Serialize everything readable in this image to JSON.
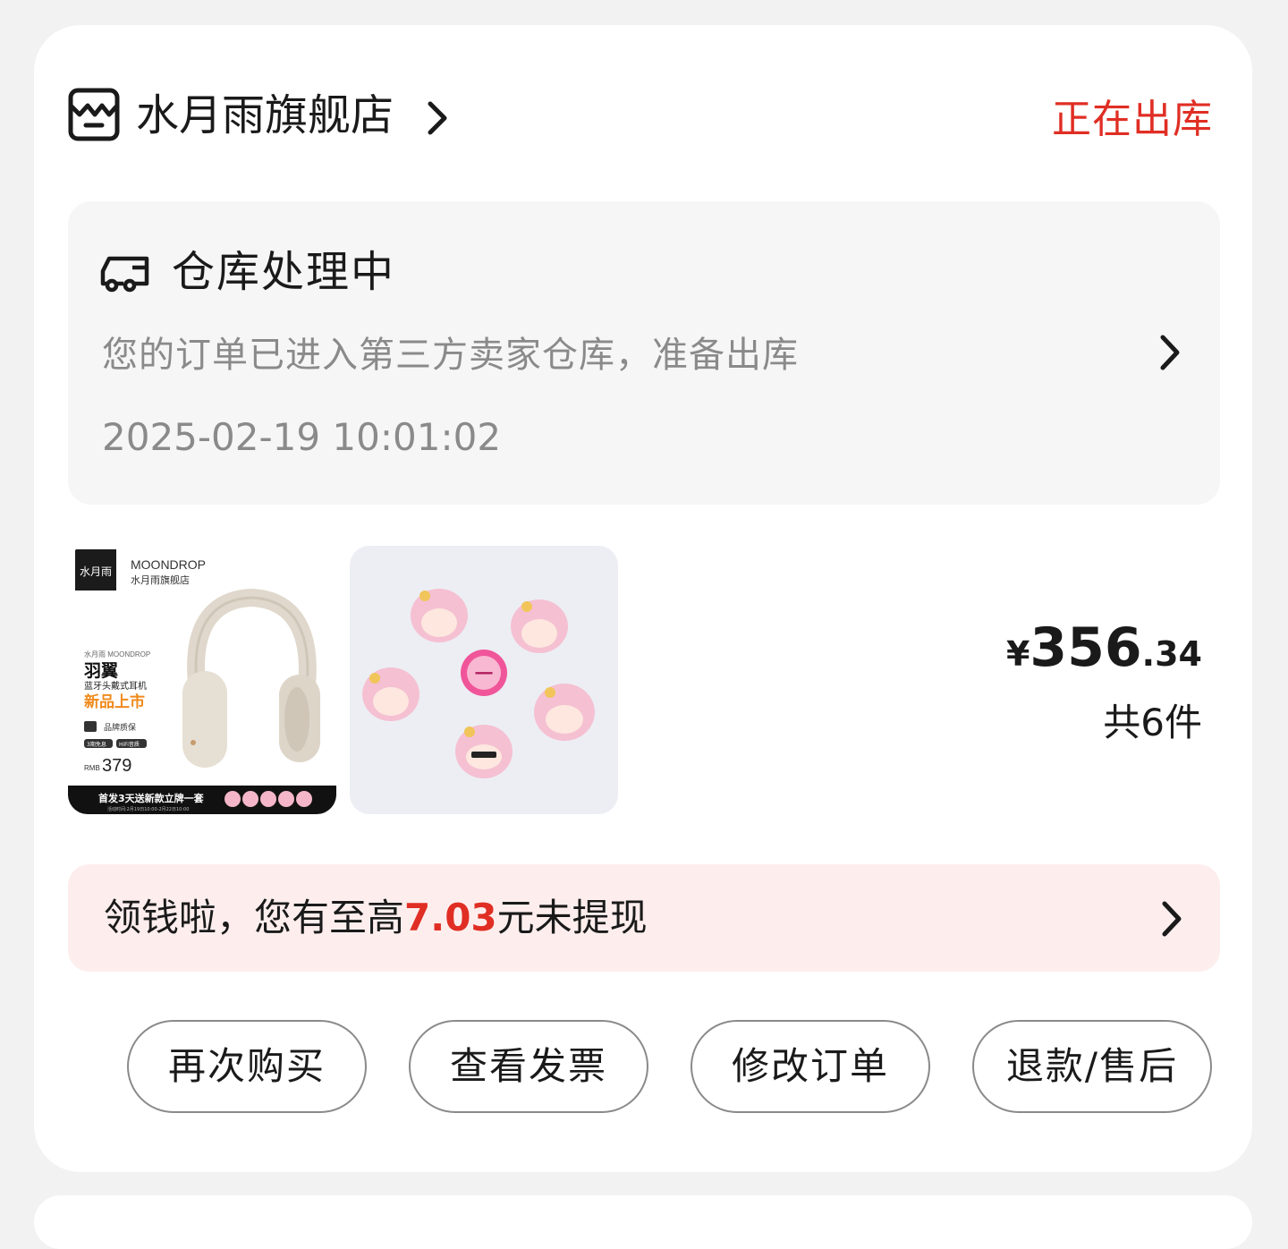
{
  "store": {
    "name": "水月雨旗舰店",
    "status": "正在出库"
  },
  "logistics": {
    "title": "仓库处理中",
    "description": "您的订单已进入第三方卖家仓库，准备出库",
    "time": "2025-02-19 10:01:02"
  },
  "products": [
    {
      "brand_en": "MOONDROP",
      "brand_cn": "水月雨旗舰店",
      "logo_text": "水月雨",
      "series": "水月雨 MOONDROP",
      "name": "羽翼",
      "subtitle": "蓝牙头戴式耳机",
      "launch": "新品上市",
      "guarantee": "品牌质保",
      "tag_1": "3期免息",
      "tag_2": "HiFi音质",
      "price_currency": "RMB",
      "price_value": "379",
      "promo": "首发3天送新款立牌一套",
      "promo_note": "活动时间:2月19日10:00-2月22日10:00"
    },
    {
      "badge_text": "一"
    }
  ],
  "order": {
    "currency": "¥",
    "price_int": "356",
    "price_dec": ".34",
    "quantity": "共6件"
  },
  "cashback": {
    "prefix": "领钱啦，您有至高",
    "amount": "7.03",
    "suffix": "元未提现"
  },
  "buttons": {
    "rebuy": "再次购买",
    "invoice": "查看发票",
    "modify": "修改订单",
    "refund": "退款/售后"
  },
  "colors": {
    "accent_red": "#e02e24",
    "banner_bg": "#fdeeed",
    "muted_text": "#8a8a8a"
  },
  "icons": {
    "store": "store-icon",
    "truck": "truck-icon",
    "chevron": "chevron-right-icon"
  }
}
